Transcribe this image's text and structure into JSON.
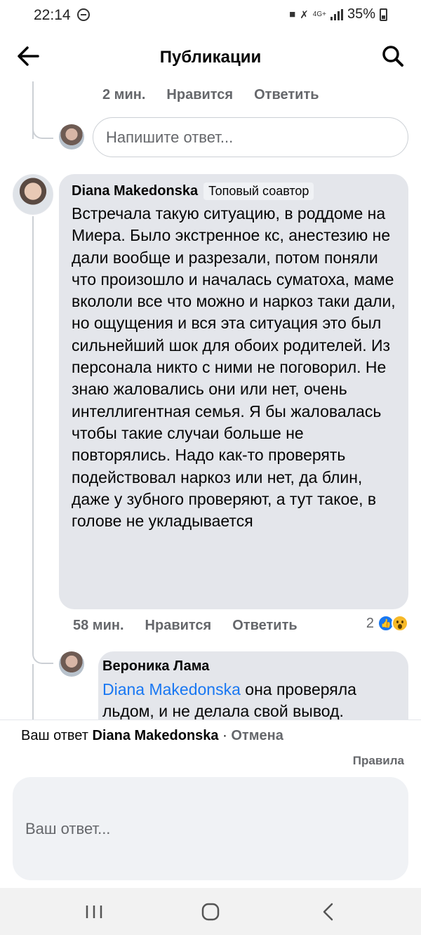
{
  "status_bar": {
    "time": "22:14",
    "network": "4G+",
    "battery": "35%"
  },
  "header": {
    "title": "Публикации",
    "back_icon": "arrow-left-icon",
    "search_icon": "search-icon"
  },
  "prev_comment": {
    "time": "2 мин.",
    "like_label": "Нравится",
    "reply_label": "Ответить",
    "reply_placeholder": "Напишите ответ..."
  },
  "comment": {
    "author": "Diana Makedonska",
    "badge": "Топовый соавтор",
    "text": "Встречала такую ситуацию, в роддоме на Миера. Было экстренное кс, анестезию не дали вообще и разрезали, потом поняли что произошло и началась суматоха, маме вкололи все что можно и наркоз таки дали, но ощущения и вся эта ситуация это был сильнейший шок для обоих родителей. Из персонала никто с ними не поговорил. Не знаю жаловались они или нет, очень интеллигентная семья. Я бы жаловалась чтобы такие случаи больше не повторялись. Надо как-то проверять подействовал наркоз или нет, да блин, даже у зубного проверяют, а тут такое, в голове не укладывается",
    "time": "58 мин.",
    "like_label": "Нравится",
    "reply_label": "Ответить",
    "reaction_count": "2",
    "reactions": [
      "like-icon",
      "wow-icon"
    ]
  },
  "reply": {
    "author": "Вероника Лама",
    "mention": "Diana Makedonska",
    "text": " она проверяла льдом, и не делала свой вывод."
  },
  "composer": {
    "replying_prefix": "Ваш ответ ",
    "replying_to": "Diana Makedonska",
    "separator": " · ",
    "cancel_label": "Отмена",
    "rules_label": "Правила",
    "placeholder": "Ваш ответ..."
  },
  "colors": {
    "accent": "#1877f2",
    "bubble": "#e4e6eb",
    "secondary_text": "#65676b"
  }
}
